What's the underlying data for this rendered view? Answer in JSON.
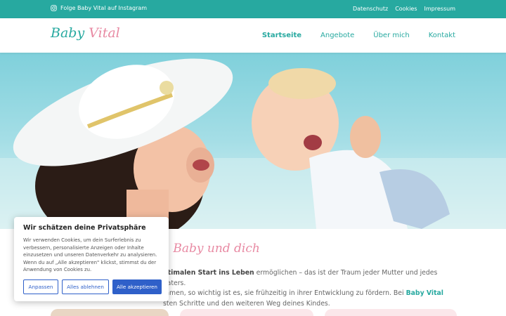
{
  "topbar": {
    "instagram_text": "Folge Baby Vital auf Instagram",
    "links": [
      "Datenschutz",
      "Cookies",
      "Impressum"
    ]
  },
  "header": {
    "logo_baby": "Baby",
    "logo_vital": "Vital",
    "nav": [
      {
        "label": "Startseite",
        "active": true
      },
      {
        "label": "Angebote",
        "active": false
      },
      {
        "label": "Über mich",
        "active": false
      },
      {
        "label": "Kontakt",
        "active": false
      }
    ]
  },
  "main": {
    "heading_visible": "n Baby und dich",
    "para_line1_strong": "ptimalen Start ins Leben",
    "para_line1_rest": " ermöglichen – das ist der Traum jeder Mutter und jedes Vaters.",
    "para_line2": "mmen, so wichtig ist es, sie frühzeitig in ihrer Entwicklung zu fördern. Bei ",
    "para_brand": "Baby Vital",
    "para_line3": "sten Schritte und den weiteren Weg deines Kindes."
  },
  "cookie": {
    "title": "Wir schätzen deine Privatsphäre",
    "text": "Wir verwenden Cookies, um dein Surferlebnis zu verbessern, personalisierte Anzeigen oder Inhalte einzusetzen und unseren Datenverkehr zu analysieren. Wenn du auf „Alle akzeptieren\" klickst, stimmst du der Anwendung von Cookies zu.",
    "btn_customize": "Anpassen",
    "btn_reject": "Alles ablehnen",
    "btn_accept": "Alle akzeptieren"
  },
  "colors": {
    "teal": "#27a9a0",
    "pink": "#e88aa3",
    "cookie_blue": "#2f60c9"
  }
}
